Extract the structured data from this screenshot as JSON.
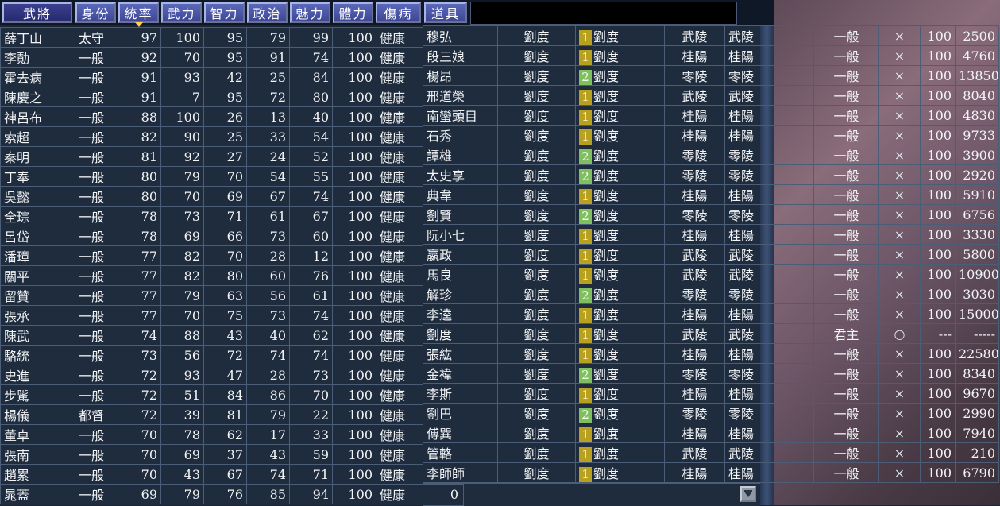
{
  "header": {
    "buttons": [
      "武將",
      "身份",
      "統率",
      "武力",
      "智力",
      "政治",
      "魅力",
      "體力",
      "傷病",
      "道具"
    ]
  },
  "left_rows": [
    [
      "薛丁山",
      "太守",
      "97",
      "100",
      "95",
      "79",
      "99",
      "100",
      "健康"
    ],
    [
      "李勣",
      "一般",
      "92",
      "70",
      "95",
      "91",
      "74",
      "100",
      "健康"
    ],
    [
      "霍去病",
      "一般",
      "91",
      "93",
      "42",
      "25",
      "84",
      "100",
      "健康"
    ],
    [
      "陳慶之",
      "一般",
      "91",
      "7",
      "95",
      "72",
      "80",
      "100",
      "健康"
    ],
    [
      "神呂布",
      "一般",
      "88",
      "100",
      "26",
      "13",
      "40",
      "100",
      "健康"
    ],
    [
      "索超",
      "一般",
      "82",
      "90",
      "25",
      "33",
      "54",
      "100",
      "健康"
    ],
    [
      "秦明",
      "一般",
      "81",
      "92",
      "27",
      "24",
      "52",
      "100",
      "健康"
    ],
    [
      "丁奉",
      "一般",
      "80",
      "79",
      "70",
      "54",
      "55",
      "100",
      "健康"
    ],
    [
      "吳懿",
      "一般",
      "80",
      "70",
      "69",
      "67",
      "74",
      "100",
      "健康"
    ],
    [
      "全琮",
      "一般",
      "78",
      "73",
      "71",
      "61",
      "67",
      "100",
      "健康"
    ],
    [
      "呂岱",
      "一般",
      "78",
      "69",
      "66",
      "73",
      "60",
      "100",
      "健康"
    ],
    [
      "潘璋",
      "一般",
      "77",
      "82",
      "70",
      "28",
      "12",
      "100",
      "健康"
    ],
    [
      "關平",
      "一般",
      "77",
      "82",
      "80",
      "60",
      "76",
      "100",
      "健康"
    ],
    [
      "留贊",
      "一般",
      "77",
      "79",
      "63",
      "56",
      "61",
      "100",
      "健康"
    ],
    [
      "張承",
      "一般",
      "77",
      "70",
      "75",
      "73",
      "74",
      "100",
      "健康"
    ],
    [
      "陳武",
      "一般",
      "74",
      "88",
      "43",
      "40",
      "62",
      "100",
      "健康"
    ],
    [
      "駱統",
      "一般",
      "73",
      "56",
      "72",
      "74",
      "74",
      "100",
      "健康"
    ],
    [
      "史進",
      "一般",
      "72",
      "93",
      "47",
      "28",
      "73",
      "100",
      "健康"
    ],
    [
      "步騭",
      "一般",
      "72",
      "51",
      "84",
      "86",
      "70",
      "100",
      "健康"
    ],
    [
      "楊儀",
      "都督",
      "72",
      "39",
      "81",
      "79",
      "22",
      "100",
      "健康"
    ],
    [
      "董卓",
      "一般",
      "70",
      "78",
      "62",
      "17",
      "33",
      "100",
      "健康"
    ],
    [
      "張南",
      "一般",
      "70",
      "69",
      "37",
      "43",
      "59",
      "100",
      "健康"
    ],
    [
      "趙累",
      "一般",
      "70",
      "43",
      "67",
      "74",
      "71",
      "100",
      "健康"
    ],
    [
      "晁蓋",
      "一般",
      "69",
      "79",
      "76",
      "85",
      "94",
      "100",
      "健康"
    ]
  ],
  "right_rows": [
    [
      "穆弘",
      "劉度",
      "1",
      "劉度",
      "武陵",
      "武陵",
      "一般",
      "×",
      "100",
      "2500"
    ],
    [
      "段三娘",
      "劉度",
      "1",
      "劉度",
      "桂陽",
      "桂陽",
      "一般",
      "×",
      "100",
      "4760"
    ],
    [
      "楊昂",
      "劉度",
      "2",
      "劉度",
      "零陵",
      "零陵",
      "一般",
      "×",
      "100",
      "13850"
    ],
    [
      "邢道榮",
      "劉度",
      "1",
      "劉度",
      "武陵",
      "武陵",
      "一般",
      "×",
      "100",
      "8040"
    ],
    [
      "南蠻頭目",
      "劉度",
      "1",
      "劉度",
      "桂陽",
      "桂陽",
      "一般",
      "×",
      "100",
      "4830"
    ],
    [
      "石秀",
      "劉度",
      "1",
      "劉度",
      "桂陽",
      "桂陽",
      "一般",
      "×",
      "100",
      "9733"
    ],
    [
      "譚雄",
      "劉度",
      "2",
      "劉度",
      "零陵",
      "零陵",
      "一般",
      "×",
      "100",
      "3900"
    ],
    [
      "太史享",
      "劉度",
      "2",
      "劉度",
      "零陵",
      "零陵",
      "一般",
      "×",
      "100",
      "2920"
    ],
    [
      "典韋",
      "劉度",
      "1",
      "劉度",
      "桂陽",
      "桂陽",
      "一般",
      "×",
      "100",
      "5910"
    ],
    [
      "劉賢",
      "劉度",
      "2",
      "劉度",
      "零陵",
      "零陵",
      "一般",
      "×",
      "100",
      "6756"
    ],
    [
      "阮小七",
      "劉度",
      "1",
      "劉度",
      "桂陽",
      "桂陽",
      "一般",
      "×",
      "100",
      "3330"
    ],
    [
      "嬴政",
      "劉度",
      "1",
      "劉度",
      "武陵",
      "武陵",
      "一般",
      "×",
      "100",
      "5800"
    ],
    [
      "馬良",
      "劉度",
      "1",
      "劉度",
      "武陵",
      "武陵",
      "一般",
      "×",
      "100",
      "10900"
    ],
    [
      "解珍",
      "劉度",
      "2",
      "劉度",
      "零陵",
      "零陵",
      "一般",
      "×",
      "100",
      "3030"
    ],
    [
      "李逵",
      "劉度",
      "1",
      "劉度",
      "桂陽",
      "桂陽",
      "一般",
      "×",
      "100",
      "15000"
    ],
    [
      "劉度",
      "劉度",
      "1",
      "劉度",
      "武陵",
      "武陵",
      "君主",
      "○",
      "---",
      "-----"
    ],
    [
      "張紘",
      "劉度",
      "1",
      "劉度",
      "桂陽",
      "桂陽",
      "一般",
      "×",
      "100",
      "22580"
    ],
    [
      "金褘",
      "劉度",
      "2",
      "劉度",
      "零陵",
      "零陵",
      "一般",
      "×",
      "100",
      "8340"
    ],
    [
      "李斯",
      "劉度",
      "1",
      "劉度",
      "桂陽",
      "桂陽",
      "一般",
      "×",
      "100",
      "9670"
    ],
    [
      "劉巴",
      "劉度",
      "2",
      "劉度",
      "零陵",
      "零陵",
      "一般",
      "×",
      "100",
      "2990"
    ],
    [
      "傅巽",
      "劉度",
      "1",
      "劉度",
      "桂陽",
      "桂陽",
      "一般",
      "×",
      "100",
      "7940"
    ],
    [
      "管輅",
      "劉度",
      "1",
      "劉度",
      "武陵",
      "武陵",
      "一般",
      "×",
      "100",
      "210"
    ],
    [
      "李師師",
      "劉度",
      "1",
      "劉度",
      "桂陽",
      "桂陽",
      "一般",
      "×",
      "100",
      "6790"
    ]
  ],
  "footer": {
    "count": "0"
  },
  "colors": {
    "badge_1": "#b8a020",
    "badge_2": "#7fbf60",
    "header_btn": "#4b56a8"
  }
}
